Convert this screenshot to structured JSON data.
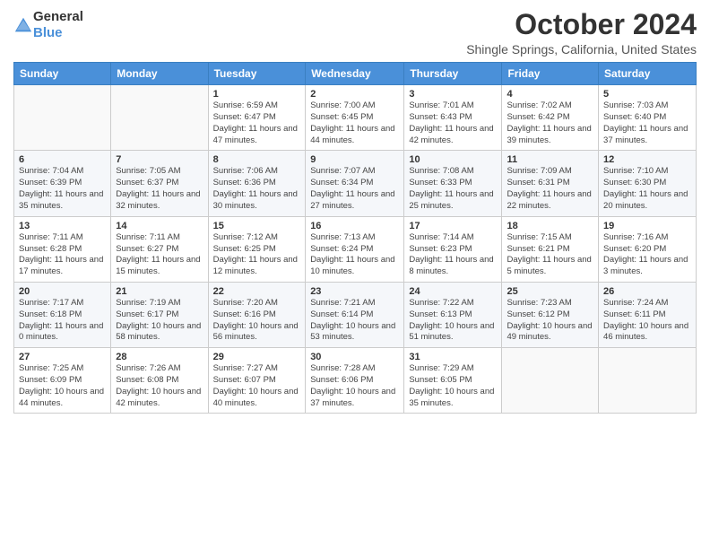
{
  "header": {
    "logo_general": "General",
    "logo_blue": "Blue",
    "main_title": "October 2024",
    "subtitle": "Shingle Springs, California, United States"
  },
  "days_of_week": [
    "Sunday",
    "Monday",
    "Tuesday",
    "Wednesday",
    "Thursday",
    "Friday",
    "Saturday"
  ],
  "weeks": [
    [
      {
        "day": "",
        "sunrise": "",
        "sunset": "",
        "daylight": ""
      },
      {
        "day": "",
        "sunrise": "",
        "sunset": "",
        "daylight": ""
      },
      {
        "day": "1",
        "sunrise": "Sunrise: 6:59 AM",
        "sunset": "Sunset: 6:47 PM",
        "daylight": "Daylight: 11 hours and 47 minutes."
      },
      {
        "day": "2",
        "sunrise": "Sunrise: 7:00 AM",
        "sunset": "Sunset: 6:45 PM",
        "daylight": "Daylight: 11 hours and 44 minutes."
      },
      {
        "day": "3",
        "sunrise": "Sunrise: 7:01 AM",
        "sunset": "Sunset: 6:43 PM",
        "daylight": "Daylight: 11 hours and 42 minutes."
      },
      {
        "day": "4",
        "sunrise": "Sunrise: 7:02 AM",
        "sunset": "Sunset: 6:42 PM",
        "daylight": "Daylight: 11 hours and 39 minutes."
      },
      {
        "day": "5",
        "sunrise": "Sunrise: 7:03 AM",
        "sunset": "Sunset: 6:40 PM",
        "daylight": "Daylight: 11 hours and 37 minutes."
      }
    ],
    [
      {
        "day": "6",
        "sunrise": "Sunrise: 7:04 AM",
        "sunset": "Sunset: 6:39 PM",
        "daylight": "Daylight: 11 hours and 35 minutes."
      },
      {
        "day": "7",
        "sunrise": "Sunrise: 7:05 AM",
        "sunset": "Sunset: 6:37 PM",
        "daylight": "Daylight: 11 hours and 32 minutes."
      },
      {
        "day": "8",
        "sunrise": "Sunrise: 7:06 AM",
        "sunset": "Sunset: 6:36 PM",
        "daylight": "Daylight: 11 hours and 30 minutes."
      },
      {
        "day": "9",
        "sunrise": "Sunrise: 7:07 AM",
        "sunset": "Sunset: 6:34 PM",
        "daylight": "Daylight: 11 hours and 27 minutes."
      },
      {
        "day": "10",
        "sunrise": "Sunrise: 7:08 AM",
        "sunset": "Sunset: 6:33 PM",
        "daylight": "Daylight: 11 hours and 25 minutes."
      },
      {
        "day": "11",
        "sunrise": "Sunrise: 7:09 AM",
        "sunset": "Sunset: 6:31 PM",
        "daylight": "Daylight: 11 hours and 22 minutes."
      },
      {
        "day": "12",
        "sunrise": "Sunrise: 7:10 AM",
        "sunset": "Sunset: 6:30 PM",
        "daylight": "Daylight: 11 hours and 20 minutes."
      }
    ],
    [
      {
        "day": "13",
        "sunrise": "Sunrise: 7:11 AM",
        "sunset": "Sunset: 6:28 PM",
        "daylight": "Daylight: 11 hours and 17 minutes."
      },
      {
        "day": "14",
        "sunrise": "Sunrise: 7:11 AM",
        "sunset": "Sunset: 6:27 PM",
        "daylight": "Daylight: 11 hours and 15 minutes."
      },
      {
        "day": "15",
        "sunrise": "Sunrise: 7:12 AM",
        "sunset": "Sunset: 6:25 PM",
        "daylight": "Daylight: 11 hours and 12 minutes."
      },
      {
        "day": "16",
        "sunrise": "Sunrise: 7:13 AM",
        "sunset": "Sunset: 6:24 PM",
        "daylight": "Daylight: 11 hours and 10 minutes."
      },
      {
        "day": "17",
        "sunrise": "Sunrise: 7:14 AM",
        "sunset": "Sunset: 6:23 PM",
        "daylight": "Daylight: 11 hours and 8 minutes."
      },
      {
        "day": "18",
        "sunrise": "Sunrise: 7:15 AM",
        "sunset": "Sunset: 6:21 PM",
        "daylight": "Daylight: 11 hours and 5 minutes."
      },
      {
        "day": "19",
        "sunrise": "Sunrise: 7:16 AM",
        "sunset": "Sunset: 6:20 PM",
        "daylight": "Daylight: 11 hours and 3 minutes."
      }
    ],
    [
      {
        "day": "20",
        "sunrise": "Sunrise: 7:17 AM",
        "sunset": "Sunset: 6:18 PM",
        "daylight": "Daylight: 11 hours and 0 minutes."
      },
      {
        "day": "21",
        "sunrise": "Sunrise: 7:19 AM",
        "sunset": "Sunset: 6:17 PM",
        "daylight": "Daylight: 10 hours and 58 minutes."
      },
      {
        "day": "22",
        "sunrise": "Sunrise: 7:20 AM",
        "sunset": "Sunset: 6:16 PM",
        "daylight": "Daylight: 10 hours and 56 minutes."
      },
      {
        "day": "23",
        "sunrise": "Sunrise: 7:21 AM",
        "sunset": "Sunset: 6:14 PM",
        "daylight": "Daylight: 10 hours and 53 minutes."
      },
      {
        "day": "24",
        "sunrise": "Sunrise: 7:22 AM",
        "sunset": "Sunset: 6:13 PM",
        "daylight": "Daylight: 10 hours and 51 minutes."
      },
      {
        "day": "25",
        "sunrise": "Sunrise: 7:23 AM",
        "sunset": "Sunset: 6:12 PM",
        "daylight": "Daylight: 10 hours and 49 minutes."
      },
      {
        "day": "26",
        "sunrise": "Sunrise: 7:24 AM",
        "sunset": "Sunset: 6:11 PM",
        "daylight": "Daylight: 10 hours and 46 minutes."
      }
    ],
    [
      {
        "day": "27",
        "sunrise": "Sunrise: 7:25 AM",
        "sunset": "Sunset: 6:09 PM",
        "daylight": "Daylight: 10 hours and 44 minutes."
      },
      {
        "day": "28",
        "sunrise": "Sunrise: 7:26 AM",
        "sunset": "Sunset: 6:08 PM",
        "daylight": "Daylight: 10 hours and 42 minutes."
      },
      {
        "day": "29",
        "sunrise": "Sunrise: 7:27 AM",
        "sunset": "Sunset: 6:07 PM",
        "daylight": "Daylight: 10 hours and 40 minutes."
      },
      {
        "day": "30",
        "sunrise": "Sunrise: 7:28 AM",
        "sunset": "Sunset: 6:06 PM",
        "daylight": "Daylight: 10 hours and 37 minutes."
      },
      {
        "day": "31",
        "sunrise": "Sunrise: 7:29 AM",
        "sunset": "Sunset: 6:05 PM",
        "daylight": "Daylight: 10 hours and 35 minutes."
      },
      {
        "day": "",
        "sunrise": "",
        "sunset": "",
        "daylight": ""
      },
      {
        "day": "",
        "sunrise": "",
        "sunset": "",
        "daylight": ""
      }
    ]
  ]
}
